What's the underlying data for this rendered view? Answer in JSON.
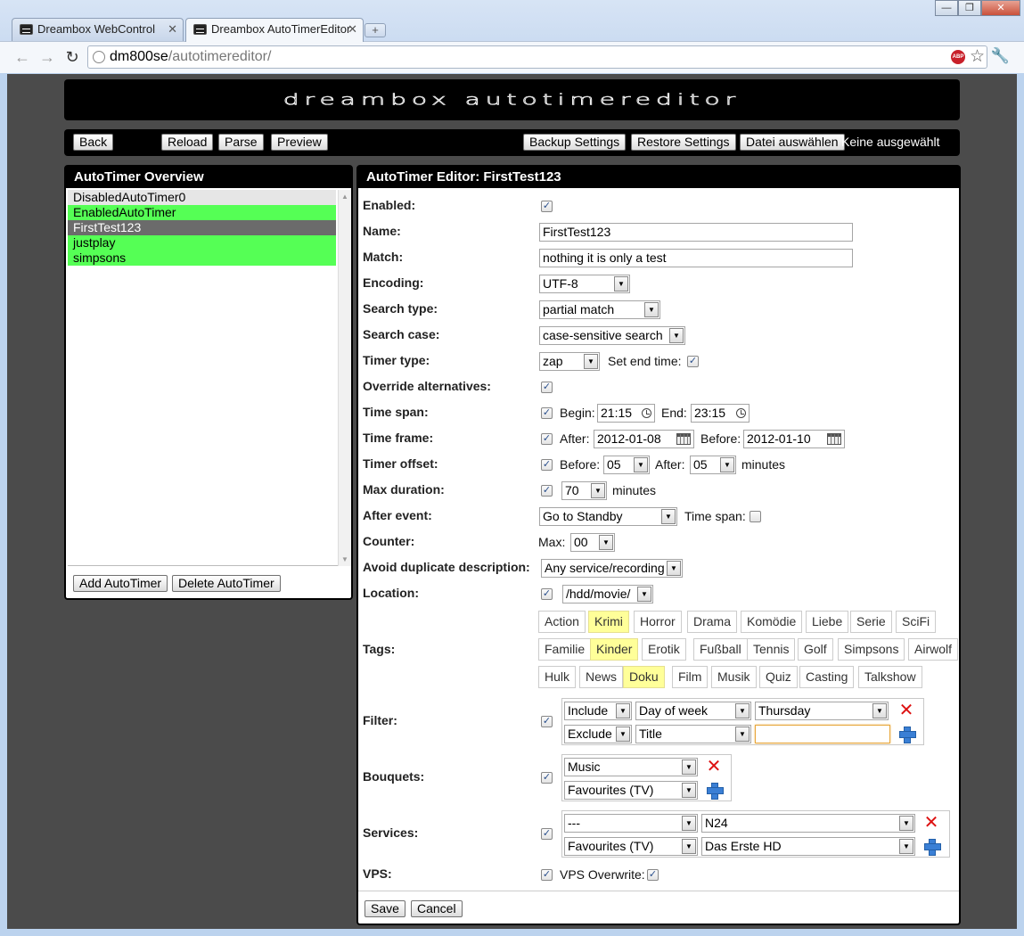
{
  "browser": {
    "tabs": [
      {
        "title": "Dreambox WebControl"
      },
      {
        "title": "Dreambox AutoTimerEditor"
      }
    ],
    "new_tab_label": "+",
    "url_host": "dm800se",
    "url_path": "/autotimereditor/",
    "abp_label": "ABP"
  },
  "banner": {
    "title": "dreambox autotimereditor"
  },
  "buttons": {
    "back": "Back",
    "reload": "Reload",
    "parse": "Parse",
    "preview": "Preview",
    "backup": "Backup Settings",
    "restore": "Restore Settings",
    "choose_file": "Datei auswählen",
    "file_status": "Keine ausgewählt"
  },
  "overview": {
    "title": "AutoTimer Overview",
    "items": [
      {
        "name": "DisabledAutoTimer0",
        "state": "disabled"
      },
      {
        "name": "EnabledAutoTimer",
        "state": "enabled"
      },
      {
        "name": "FirstTest123",
        "state": "selected"
      },
      {
        "name": "justplay",
        "state": "enabled"
      },
      {
        "name": "simpsons",
        "state": "enabled"
      }
    ],
    "add_button": "Add AutoTimer",
    "delete_button": "Delete AutoTimer"
  },
  "editor": {
    "title": "AutoTimer Editor: FirstTest123",
    "labels": {
      "enabled": "Enabled:",
      "name": "Name:",
      "match": "Match:",
      "encoding": "Encoding:",
      "search_type": "Search type:",
      "search_case": "Search case:",
      "timer_type": "Timer type:",
      "override": "Override alternatives:",
      "time_span": "Time span:",
      "time_frame": "Time frame:",
      "timer_offset": "Timer offset:",
      "max_duration": "Max duration:",
      "after_event": "After event:",
      "counter": "Counter:",
      "avoid_dup": "Avoid duplicate description:",
      "location": "Location:",
      "tags": "Tags:",
      "filter": "Filter:",
      "bouquets": "Bouquets:",
      "services": "Services:",
      "vps": "VPS:"
    },
    "name_value": "FirstTest123",
    "match_value": "nothing it is only a test",
    "encoding_value": "UTF-8",
    "search_type_value": "partial match",
    "search_case_value": "case-sensitive search",
    "timer_type_value": "zap",
    "set_end_time_label": "Set end time:",
    "begin_label": "Begin:",
    "begin_value": "21:15",
    "end_label": "End:",
    "end_value": "23:15",
    "after_label": "After:",
    "after_date": "2012-01-08",
    "before_label": "Before:",
    "before_date": "2012-01-10",
    "offset_before_label": "Before:",
    "offset_before_value": "05",
    "offset_after_label": "After:",
    "offset_after_value": "05",
    "minutes_label": "minutes",
    "max_duration_value": "70",
    "max_duration_unit": "minutes",
    "after_event_value": "Go to Standby",
    "after_event_timespan_label": "Time span:",
    "counter_max_label": "Max:",
    "counter_value": "00",
    "avoid_dup_value": "Any service/recording",
    "location_value": "/hdd/movie/",
    "tag_rows": [
      [
        {
          "label": "Action",
          "selected": false
        },
        {
          "label": "Krimi",
          "selected": true
        },
        {
          "label": "Horror",
          "selected": false
        },
        {
          "label": "Drama",
          "selected": false
        },
        {
          "label": "Komödie",
          "selected": false
        },
        {
          "label": "Liebe",
          "selected": false
        },
        {
          "label": "Serie",
          "selected": false
        },
        {
          "label": "SciFi",
          "selected": false
        }
      ],
      [
        {
          "label": "Familie",
          "selected": false
        },
        {
          "label": "Kinder",
          "selected": true
        },
        {
          "label": "Erotik",
          "selected": false
        },
        {
          "label": "Fußball",
          "selected": false
        },
        {
          "label": "Tennis",
          "selected": false
        },
        {
          "label": "Golf",
          "selected": false
        },
        {
          "label": "Simpsons",
          "selected": false
        },
        {
          "label": "Airwolf",
          "selected": false
        }
      ],
      [
        {
          "label": "Hulk",
          "selected": false
        },
        {
          "label": "News",
          "selected": false
        },
        {
          "label": "Doku",
          "selected": true
        },
        {
          "label": "Film",
          "selected": false
        },
        {
          "label": "Musik",
          "selected": false
        },
        {
          "label": "Quiz",
          "selected": false
        },
        {
          "label": "Casting",
          "selected": false
        },
        {
          "label": "Talkshow",
          "selected": false
        }
      ]
    ],
    "filters": [
      {
        "mode": "Include",
        "field": "Day of week",
        "value": "Thursday"
      },
      {
        "mode": "Exclude",
        "field": "Title",
        "value": ""
      }
    ],
    "bouquets": [
      "Music",
      "Favourites (TV)"
    ],
    "services": [
      {
        "bouquet": "---",
        "service": "N24"
      },
      {
        "bouquet": "Favourites (TV)",
        "service": "Das Erste HD"
      }
    ],
    "vps_overwrite_label": "VPS Overwrite:",
    "save_button": "Save",
    "cancel_button": "Cancel"
  },
  "colors": {
    "enabled_item": "#55ff55",
    "selected_item": "#6b6b6b",
    "selected_tag": "#ffff99",
    "page_background": "#4b4b4b"
  },
  "checkmark": "✓"
}
